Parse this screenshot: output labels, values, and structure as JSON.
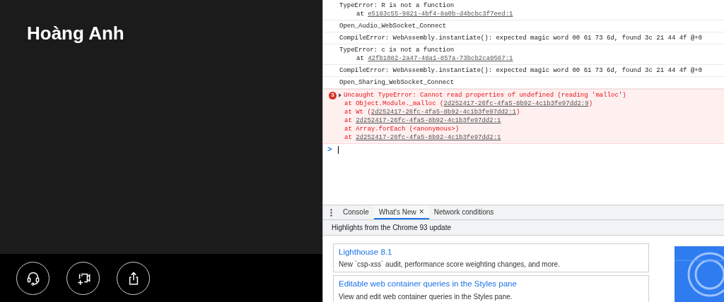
{
  "caller": {
    "name": "Hoàng Anh"
  },
  "call_controls": [
    {
      "kind": "headset"
    },
    {
      "kind": "video-add"
    },
    {
      "kind": "share"
    }
  ],
  "console": {
    "messages": [
      {
        "kind": "log",
        "text": "TypeError: R is not a function",
        "stack": [
          {
            "before": "at ",
            "link": "e5183c55-9821-4bf4-8a0b-d4bcbc3f7eed:1"
          }
        ]
      },
      {
        "kind": "log",
        "text": "Open_Audio_WebSocket_Connect"
      },
      {
        "kind": "log",
        "text": "CompileError: WebAssembly.instantiate(): expected magic word 00 61 73 6d, found 3c 21 44 4f @+0"
      },
      {
        "kind": "log",
        "text": "TypeError: c is not a function",
        "stack": [
          {
            "before": "at ",
            "link": "42fb1082-2a47-48a1-857a-73bcb2ca9567:1"
          }
        ]
      },
      {
        "kind": "log",
        "text": "CompileError: WebAssembly.instantiate(): expected magic word 00 61 73 6d, found 3c 21 44 4f @+0"
      },
      {
        "kind": "log",
        "text": "Open_Sharing_WebSocket_Connect"
      },
      {
        "kind": "error",
        "count": "3",
        "text": "Uncaught TypeError: Cannot read properties of undefined (reading 'malloc')",
        "stack": [
          {
            "before": "at Object.Module._malloc (",
            "link": "2d252417-26fc-4fa5-8b92-4c1b3fe97dd2:9",
            "after": ")"
          },
          {
            "before": "at Wt (",
            "link": "2d252417-26fc-4fa5-8b92-4c1b3fe97dd2:1",
            "after": ")"
          },
          {
            "before": "at ",
            "link": "2d252417-26fc-4fa5-8b92-4c1b3fe97dd2:1"
          },
          {
            "before": "at Array.forEach (<anonymous>)"
          },
          {
            "before": "at ",
            "link": "2d252417-26fc-4fa5-8b92-4c1b3fe97dd2:1"
          }
        ]
      }
    ],
    "prompt": ">"
  },
  "drawer": {
    "tabs": [
      {
        "label": "Console",
        "selected": false,
        "closable": false
      },
      {
        "label": "What's New",
        "selected": true,
        "closable": true
      },
      {
        "label": "Network conditions",
        "selected": false,
        "closable": false
      }
    ],
    "close_glyph": "×",
    "heading": "Highlights from the Chrome 93 update",
    "cards": [
      {
        "title": "Lighthouse 8.1",
        "description": "New `csp-xss` audit, performance score weighting changes, and more."
      },
      {
        "title": "Editable web container queries in the Styles pane",
        "description": "View and edit web container queries in the Styles pane."
      }
    ]
  }
}
